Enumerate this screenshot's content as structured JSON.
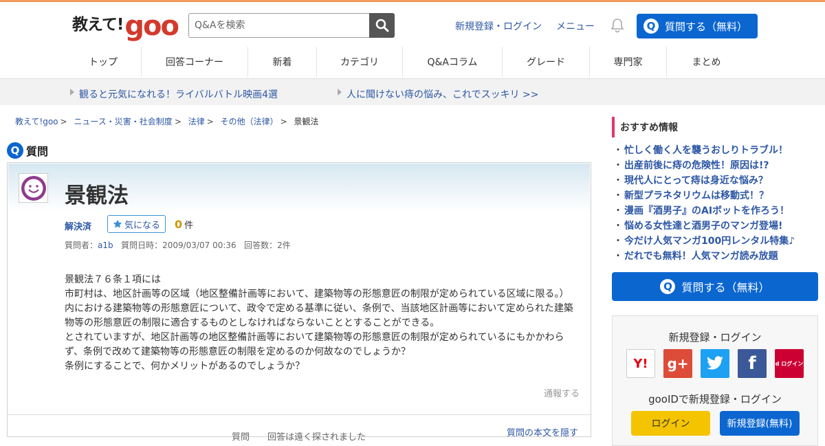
{
  "header": {
    "logo_jp": "教えて!",
    "logo_goo": "goo",
    "search_placeholder": "Q&Aを検索",
    "register_login": "新規登録・ログイン",
    "menu": "メニュー",
    "ask_button": "質問する（無料）"
  },
  "nav": {
    "items": [
      {
        "label": "トップ"
      },
      {
        "label": "回答コーナー"
      },
      {
        "label": "新着"
      },
      {
        "label": "カテゴリ"
      },
      {
        "label": "Q&Aコラム"
      },
      {
        "label": "グレード"
      },
      {
        "label": "専門家"
      },
      {
        "label": "まとめ"
      }
    ]
  },
  "promo": [
    "観ると元気になれる！ライバルバトル映画4選",
    "人に聞けない痔の悩み、これでスッキリ >>"
  ],
  "breadcrumb": {
    "items": [
      "教えて!goo",
      "ニュース・災害・社会制度",
      "法律",
      "その他（法律）"
    ],
    "current": "景観法",
    "separator": ">"
  },
  "question": {
    "section_label": "質問",
    "title": "景観法",
    "status": "解決済",
    "fav_label": "気になる",
    "fav_count": "0",
    "fav_unit": "件",
    "asker_label": "質問者：",
    "asker": "a1b",
    "date_label": "質問日時：",
    "date": "2009/03/07 00:36",
    "answers_label": "回答数：",
    "answers": "2件",
    "body": [
      "景観法７６条１項には",
      "市町村は、地区計画等の区域（地区整備計画等において、建築物等の形態意匠の制限が定められている区域に限る。）内における建築物等の形態意匠について、政令で定める基準に従い、条例で、当該地区計画等において定められた建築物等の形態意匠の制限に適合するものとしなければならないこととすることができる。",
      "とされていますが、地区計画等の地区整備計画等において建築物等の形態意匠の制限が定められているにもかかわらず、条例で改めて建築物等の形態意匠の制限を定めるのか何故なのでしょうか？",
      "条例にすることで、何かメリットがあるのでしょうか？"
    ],
    "report": "通報する",
    "hide_body": "質問の本文を隠す",
    "bottom_text": "質問　　回答は遠く探されました"
  },
  "sidebar": {
    "rec_title": "おすすめ情報",
    "rec_items": [
      "忙しく働く人を襲うおしりトラブル！",
      "出産前後に痔の危険性！原因は!?",
      "現代人にとって痔は身近な悩み？",
      "新型プラネタリウムは移動式！？",
      "漫画『酒男子』のAIボットを作ろう！",
      "悩める女性達と酒男子のマンガ登場!",
      "今だけ人気マンガ100円レンタル特集♪",
      "だれでも無料！人気マンガ読み放題"
    ],
    "ask_button": "質問する（無料）",
    "login_title": "新規登録・ログイン",
    "social": [
      "Y!",
      "g+",
      "twitter",
      "f",
      "d ログイン"
    ],
    "gooid_text": "gooIDで新規登録・ログイン",
    "login_button": "ログイン",
    "register_button": "新規登録(無料)"
  },
  "colors": {
    "accent_blue": "#0b66d0",
    "link": "#2d57a5",
    "logo_red": "#d33a2c",
    "top_bar": "#f39a5c",
    "rec_bar": "#e8336b"
  }
}
